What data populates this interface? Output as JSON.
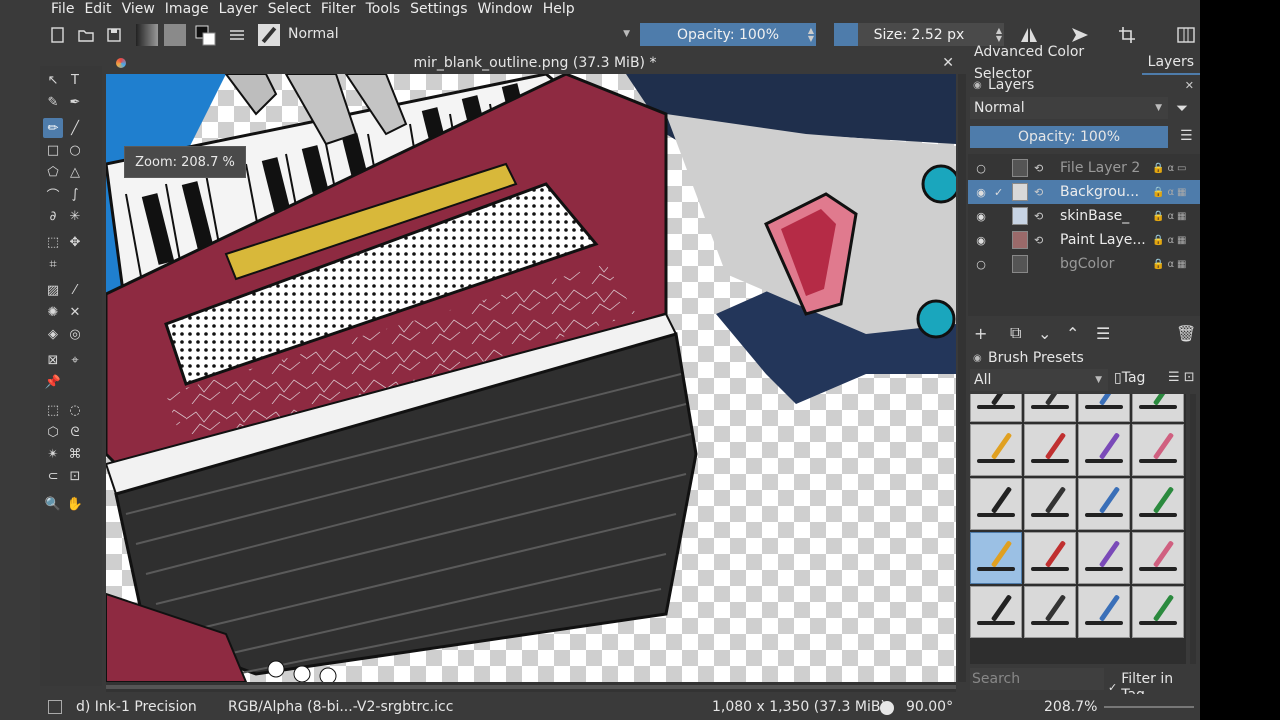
{
  "menu": [
    "File",
    "Edit",
    "View",
    "Image",
    "Layer",
    "Select",
    "Filter",
    "Tools",
    "Settings",
    "Window",
    "Help"
  ],
  "toolbar": {
    "blend_mode": "Normal",
    "opacity_label": "Opacity: 100%",
    "opacity_value": 1.0,
    "size_label": "Size: 2.52 px",
    "icons": [
      "new-document-icon",
      "open-icon",
      "save-icon",
      "gradient-icon",
      "pattern-icon",
      "color-swap-icon",
      "brush-settings-icon",
      "brush-preset-icon",
      "eraser-icon",
      "alpha-lock-icon",
      "reload-icon",
      "mirror-horizontal-icon",
      "mirror-vertical-icon",
      "wrap-around-icon",
      "workspace-icon"
    ],
    "accent": "#4e7cab"
  },
  "document": {
    "title": "mir_blank_outline.png (37.3 MiB) *",
    "zoom_tooltip": "Zoom: 208.7 %"
  },
  "docker": {
    "tabs": [
      "Advanced Color Selector",
      "Layers"
    ],
    "active_tab": "Layers",
    "layers_title": "Layers",
    "blend_mode": "Normal",
    "opacity_label": "Opacity:  100%",
    "layers": [
      {
        "name": "File Layer 2",
        "visible": false,
        "selected": false
      },
      {
        "name": "Backgrou...",
        "visible": true,
        "selected": true
      },
      {
        "name": "skinBase_",
        "visible": true,
        "selected": false
      },
      {
        "name": "Paint Laye...",
        "visible": true,
        "selected": false
      },
      {
        "name": "bgColor",
        "visible": false,
        "selected": false
      }
    ],
    "brush_presets_title": "Brush Presets",
    "brush_filter": "All",
    "tag_label": "Tag",
    "search_placeholder": "Search",
    "filter_in_tag": "Filter in Tag",
    "filter_in_tag_checked": true
  },
  "status": {
    "brush": "d) Ink-1 Precision",
    "color_profile": "RGB/Alpha (8-bi...-V2-srgbtrc.icc",
    "image_size": "1,080 x 1,350 (37.3 MiB)",
    "rotation": "90.00°",
    "zoom": "208.7%"
  }
}
